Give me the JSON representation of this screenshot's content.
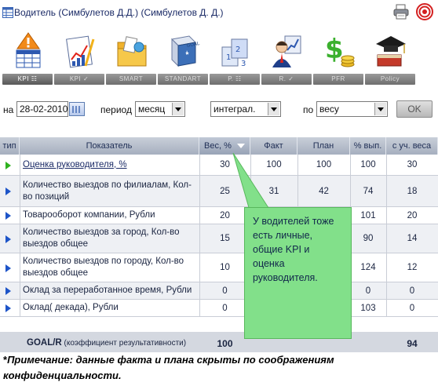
{
  "window": {
    "title": "Водитель (Симбулетов Д.Д.)  (Симбулетов Д. Д.)"
  },
  "toolbar": {
    "items": [
      {
        "label": "KPI ☷",
        "icon": "kpi-icon"
      },
      {
        "label": "KPI ✓",
        "icon": "kpi-chart-icon"
      },
      {
        "label": "SMART",
        "icon": "smart-folder-icon"
      },
      {
        "label": "STANDART",
        "icon": "goal-standart-icon"
      },
      {
        "label": "Р. ☷",
        "icon": "r-cards-icon"
      },
      {
        "label": "R. ✓",
        "icon": "person-icon"
      },
      {
        "label": "PFR",
        "icon": "money-icon"
      },
      {
        "label": "Policy",
        "icon": "graduation-cap-icon"
      }
    ]
  },
  "filters": {
    "date_label": "на",
    "date_value": "28-02-2010",
    "period_label": "период",
    "period_value": "месяц",
    "mode_value": "интеграл.",
    "by_label": "по",
    "by_value": "весу",
    "ok_label": "OK"
  },
  "table": {
    "headers": [
      "тип",
      "Показатель",
      "Вес, %",
      "Факт",
      "План",
      "% вып.",
      "с уч. веса"
    ],
    "rows": [
      {
        "type": "green",
        "name": "Оценка руководителя, %",
        "weight": "30",
        "fact": "100",
        "plan": "100",
        "pct": "100",
        "weighted": "30",
        "link": true
      },
      {
        "type": "blue",
        "name": "Количество выездов по филиалам, Кол-во позиций",
        "weight": "25",
        "fact": "31",
        "plan": "42",
        "pct": "74",
        "weighted": "18",
        "link": false
      },
      {
        "type": "blue",
        "name": "Товарооборот компании, Рубли",
        "weight": "20",
        "fact": "",
        "plan": "",
        "pct": "101",
        "weighted": "20",
        "link": false
      },
      {
        "type": "blue",
        "name": "Количество выездов за город, Кол-во выездов общее",
        "weight": "15",
        "fact": "",
        "plan": "",
        "pct": "90",
        "weighted": "14",
        "link": false
      },
      {
        "type": "blue",
        "name": "Количество выездов по городу, Кол-во выездов общее",
        "weight": "10",
        "fact": "",
        "plan": "",
        "pct": "124",
        "weighted": "12",
        "link": false
      },
      {
        "type": "blue",
        "name": "Оклад за переработанное время, Рубли",
        "weight": "0",
        "fact": "",
        "plan": "",
        "pct": "0",
        "weighted": "0",
        "link": false
      },
      {
        "type": "blue",
        "name": "Оклад( декада), Рубли",
        "weight": "0",
        "fact": "",
        "plan": "",
        "pct": "103",
        "weighted": "0",
        "link": false
      }
    ],
    "footer": {
      "label_bold": "GOAL/R",
      "label_rest": " (коэффициент результативности)",
      "weight_total": "100",
      "weighted_total": "94"
    }
  },
  "callout": {
    "text": "У водителей тоже есть личные, общие KPI и оценка руководителя."
  },
  "note": {
    "star": "*",
    "text": "Примечание: данные факта и плана скрыты по соображениям конфиденциальности."
  },
  "colors": {
    "header_bg": "#a6afbf",
    "callout_bg": "#82e08a",
    "arrow_blue": "#1d54c8",
    "arrow_green": "#2fb11f"
  }
}
